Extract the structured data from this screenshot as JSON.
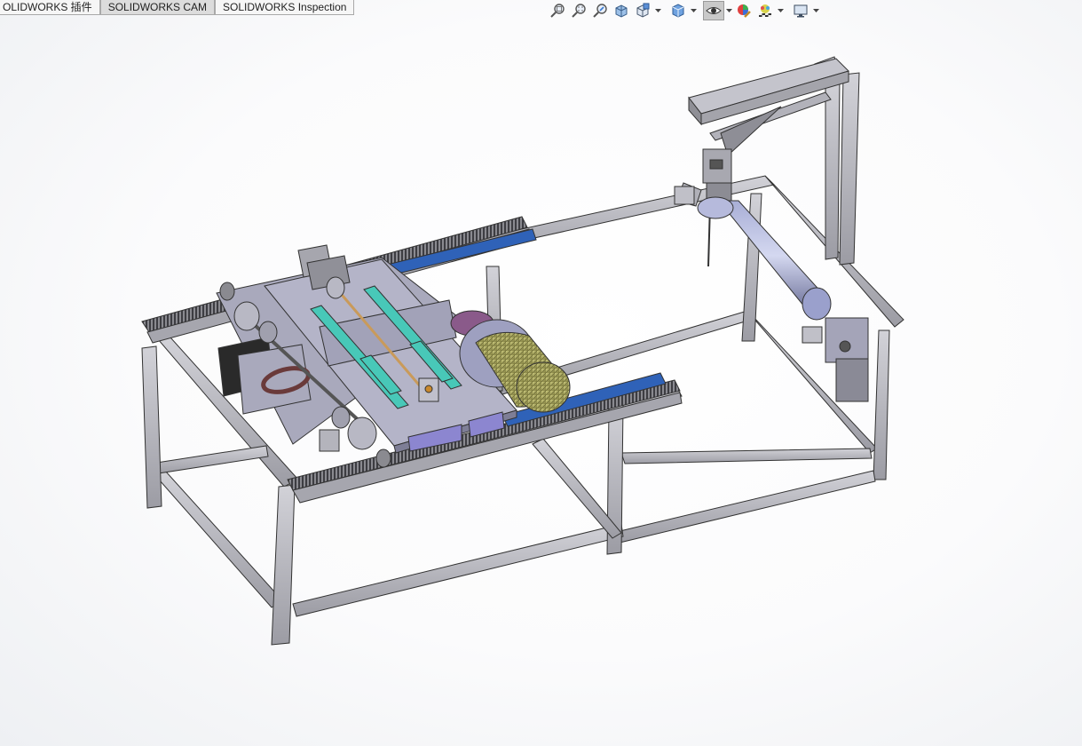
{
  "tabs": [
    {
      "label": "OLIDWORKS 插件"
    },
    {
      "label": "SOLIDWORKS CAM"
    },
    {
      "label": "SOLIDWORKS Inspection"
    }
  ],
  "heads_up_toolbar": [
    {
      "icon": "zoom-to-fit-icon"
    },
    {
      "icon": "zoom-to-area-icon"
    },
    {
      "icon": "previous-view-icon"
    },
    {
      "icon": "section-view-icon"
    },
    {
      "icon": "view-orientation-icon"
    },
    {
      "icon": "display-style-icon"
    },
    {
      "icon": "hide-show-items-icon"
    },
    {
      "icon": "edit-appearance-icon"
    },
    {
      "icon": "apply-scene-icon"
    },
    {
      "icon": "view-settings-icon"
    }
  ],
  "colors": {
    "frame": "#b8b8be",
    "frame_edge": "#3a3a3a",
    "rail": "#2f62b8",
    "plate": "#a9a9bc",
    "slider": "#48c8b8",
    "spool": "#9c9a52",
    "motor": "#2a2a2a"
  }
}
